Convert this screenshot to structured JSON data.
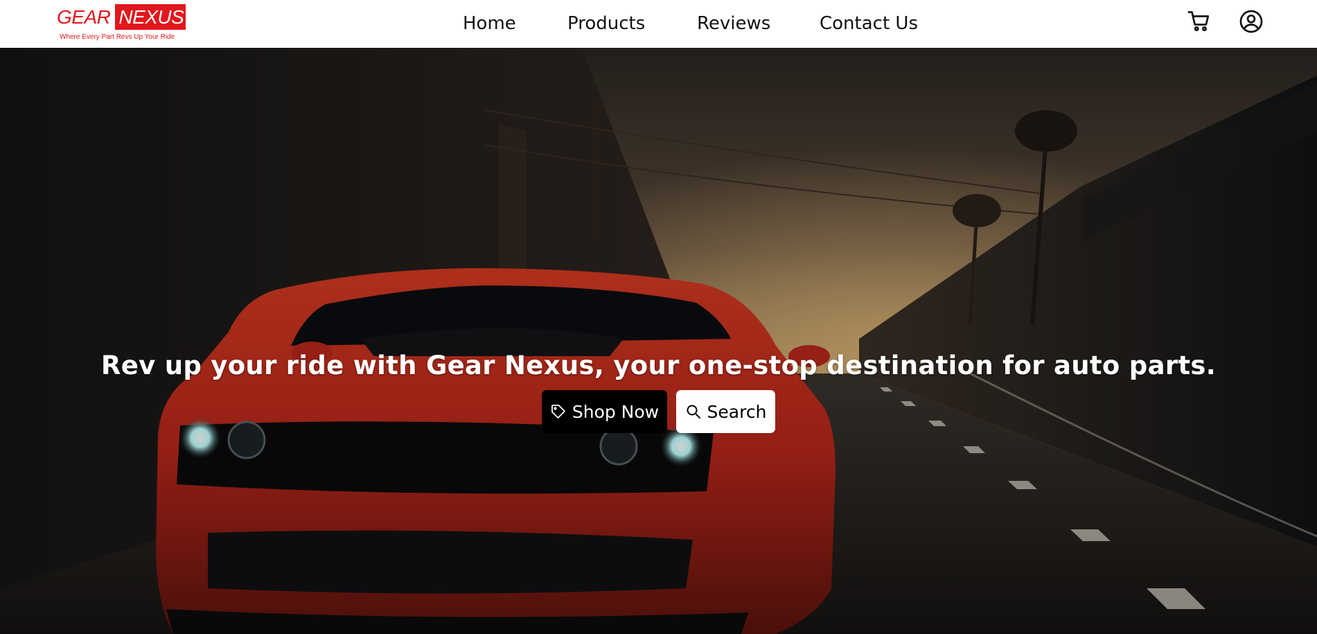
{
  "brand": {
    "name_part1": "GEAR",
    "name_part2": "NEXUS",
    "tagline": "Where Every Part Revs Up Your Ride",
    "accent_color": "#e3161c"
  },
  "nav": {
    "items": [
      {
        "label": "Home"
      },
      {
        "label": "Products"
      },
      {
        "label": "Reviews"
      },
      {
        "label": "Contact Us"
      }
    ]
  },
  "header_icons": {
    "cart": "cart-icon",
    "account": "user-circle-icon"
  },
  "hero": {
    "headline": "Rev up your ride with Gear Nexus, your one-stop destination for auto parts.",
    "shop_button": {
      "label": "Shop Now",
      "icon": "tag-icon"
    },
    "search_button": {
      "label": "Search",
      "icon": "search-icon"
    }
  }
}
